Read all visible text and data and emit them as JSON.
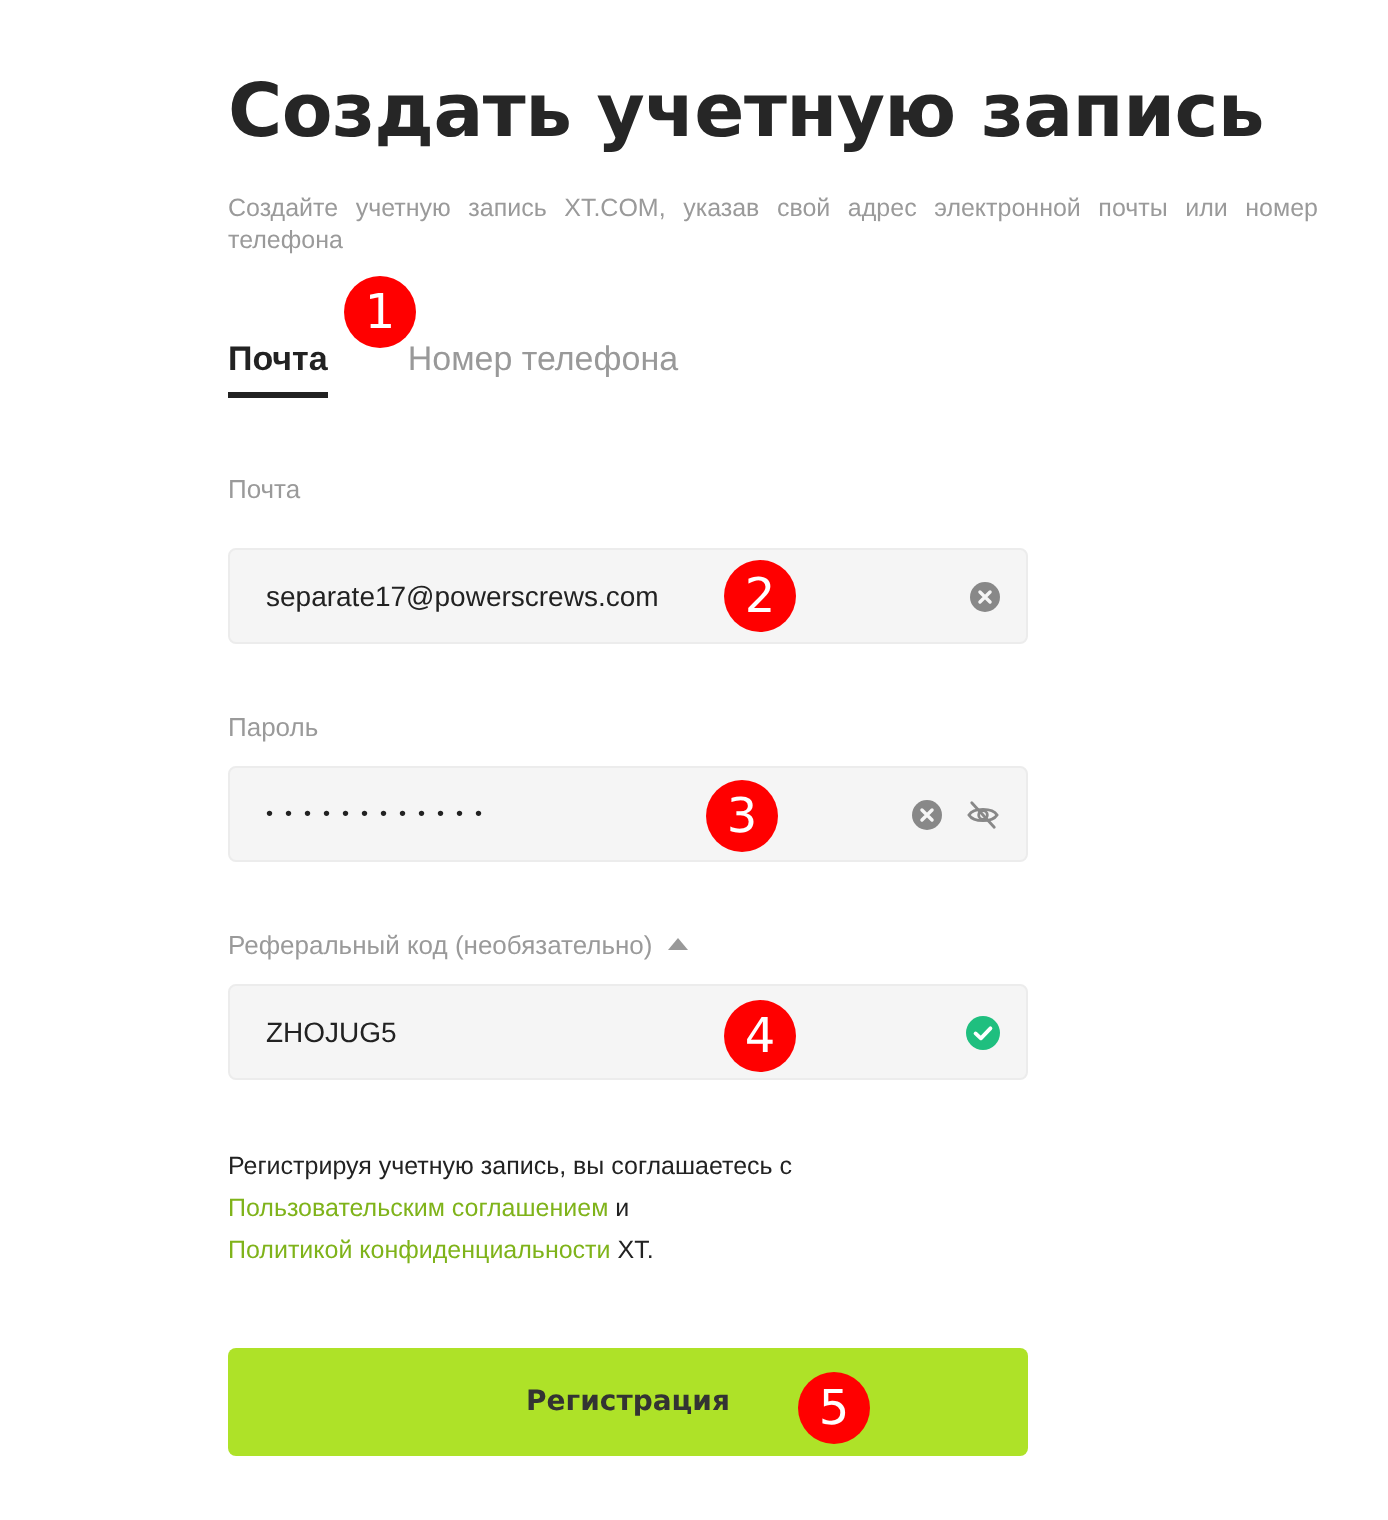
{
  "title": "Создать учетную запись",
  "subtitle": "Создайте учетную запись XT.COM, указав свой адрес электронной почты или номер телефона",
  "tabs": [
    {
      "label": "Почта",
      "selected": true
    },
    {
      "label": "Номер телефона",
      "selected": false
    }
  ],
  "fields": [
    {
      "label": "Почта",
      "value": "separate17@powerscrews.com",
      "kind": "text",
      "clearable": true,
      "reveal_toggle": false,
      "valid": false
    },
    {
      "label": "Пароль",
      "value": "••••••••••••",
      "kind": "password",
      "clearable": true,
      "reveal_toggle": true,
      "valid": false
    },
    {
      "label": "Реферальный код (необязательно)",
      "value": "ZHOJUG5",
      "kind": "referral",
      "expanded": true,
      "clearable": false,
      "reveal_toggle": false,
      "valid": true
    }
  ],
  "agreement": {
    "before": "Регистрируя учетную запись, вы соглашаетесь с",
    "link_1": "Пользовательским соглашением",
    "middle": "и",
    "link_2": "Политикой конфиденциальности",
    "after": "XT."
  },
  "submit": "Регистрация",
  "markers": [
    "1",
    "2",
    "3",
    "4",
    "5"
  ]
}
